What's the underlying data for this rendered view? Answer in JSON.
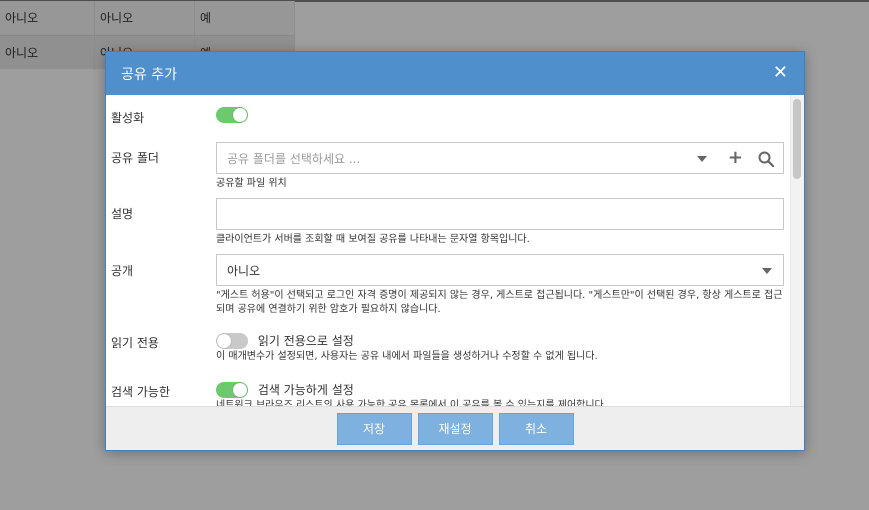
{
  "background_table": {
    "rows": [
      [
        "아니오",
        "아니오",
        "예"
      ],
      [
        "아니오",
        "아니오",
        "예"
      ]
    ]
  },
  "dialog": {
    "title": "공유 추가",
    "close_icon": "close-icon",
    "fields": {
      "enable": {
        "label": "활성화",
        "state": "on"
      },
      "share_folder": {
        "label": "공유 폴더",
        "placeholder": "공유 폴더를 선택하세요 ...",
        "hint": "공유할 파일 위치"
      },
      "description": {
        "label": "설명",
        "value": "",
        "hint": "클라이언트가 서버를 조회할 때 보여질 공유를 나타내는 문자열 항목입니다."
      },
      "public": {
        "label": "공개",
        "value": "아니오",
        "hint": "\"게스트 허용\"이 선택되고 로그인 자격 증명이 제공되지 않는 경우, 게스트로 접근됩니다. \"게스트만\"이 선택된 경우, 항상 게스트로 접근되며 공유에 연결하기 위한 암호가 필요하지 않습니다."
      },
      "read_only": {
        "label": "읽기 전용",
        "toggle_label": "읽기 전용으로 설정",
        "state": "off",
        "hint": "이 매개변수가 설정되면, 사용자는 공유 내에서 파일들을 생성하거나 수정할 수 없게 됩니다."
      },
      "browsable": {
        "label": "검색 가능한",
        "toggle_label": "검색 가능하게 설정",
        "state": "on",
        "hint": "네트워크 브라우즈 리스트의 사용 가능한 공유 목록에서 이 공유를 볼 수 있는지를 제어합니다."
      }
    },
    "buttons": {
      "save": "저장",
      "reset": "재설정",
      "cancel": "취소"
    }
  },
  "colors": {
    "header": "#4f8fcb",
    "toggle_on": "#6cc96c",
    "toggle_off": "#c9c9c9",
    "button": "#7fb1e0"
  }
}
